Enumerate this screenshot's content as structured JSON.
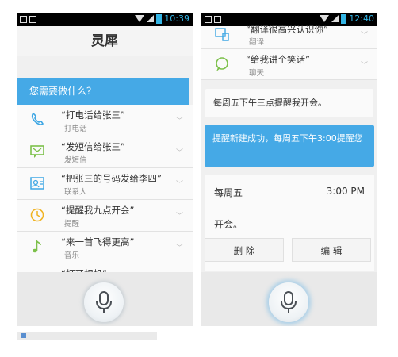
{
  "left": {
    "status_time": "10:39",
    "app_title": "灵犀",
    "prompt": "您需要做什么？",
    "items": [
      {
        "icon": "phone-icon",
        "quote": "“打电话给张三”",
        "category": "打电话"
      },
      {
        "icon": "sms-icon",
        "quote": "“发短信给张三”",
        "category": "发短信"
      },
      {
        "icon": "contact-icon",
        "quote": "“把张三的号码发给李四”",
        "category": "联系人"
      },
      {
        "icon": "clock-icon",
        "quote": "“提醒我九点开会”",
        "category": "提醒"
      },
      {
        "icon": "music-note-icon",
        "quote": "“来一首飞得更高”",
        "category": "音乐"
      },
      {
        "icon": "camera-icon",
        "quote": "“打开相机”",
        "category": ""
      }
    ]
  },
  "right": {
    "status_time": "12:40",
    "items": [
      {
        "icon": "translate-icon",
        "quote": "“翻译很高兴认识你”",
        "category": "翻译"
      },
      {
        "icon": "chat-icon",
        "quote": "“给我讲个笑话”",
        "category": "聊天"
      }
    ],
    "user_message": "每周五下午三点提醒我开会。",
    "reply": "提醒新建成功，每周五下午3:00提醒您",
    "card": {
      "day": "每周五",
      "time": "3:00 PM",
      "note": "开会。"
    },
    "delete_label": "删 除",
    "edit_label": "编 辑"
  },
  "colors": {
    "accent": "#45a9e6",
    "background": "#f0f0f0"
  }
}
